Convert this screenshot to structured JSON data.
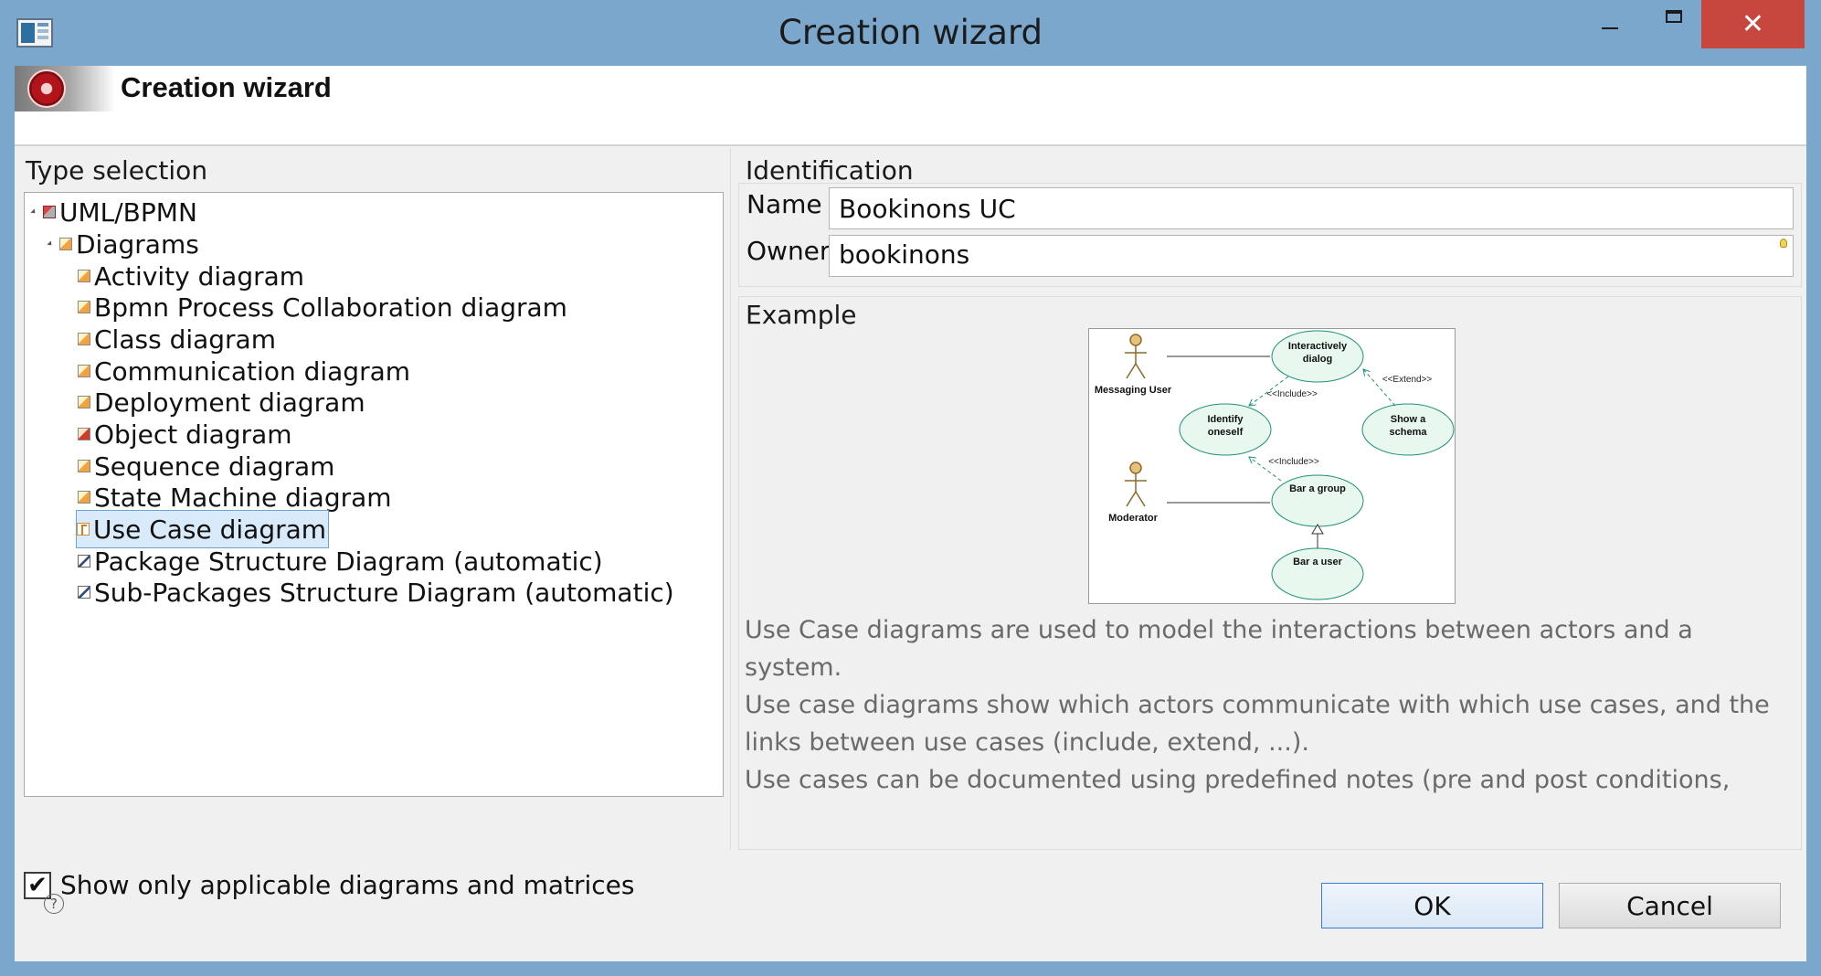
{
  "window": {
    "title": "Creation wizard",
    "close_glyph": "✕"
  },
  "banner": {
    "title": "Creation wizard"
  },
  "type_selection": {
    "label": "Type selection",
    "tree": {
      "root": "UML/BPMN",
      "group": "Diagrams",
      "items": [
        "Activity diagram",
        "Bpmn Process Collaboration diagram",
        "Class diagram",
        "Communication diagram",
        "Deployment diagram",
        "Object diagram",
        "Sequence diagram",
        "State Machine diagram",
        "Use Case diagram",
        "Package Structure Diagram (automatic)",
        "Sub-Packages Structure Diagram (automatic)"
      ],
      "selected": "Use Case diagram"
    },
    "show_only_applicable": {
      "label": "Show only applicable diagrams and matrices",
      "checked": true,
      "check_glyph": "✔"
    }
  },
  "identification": {
    "label": "Identification",
    "name_label": "Name",
    "name_value": "Bookinons UC",
    "owner_label": "Owner",
    "owner_value": "bookinons"
  },
  "example": {
    "label": "Example",
    "diagram": {
      "actors": [
        "Messaging User",
        "Moderator"
      ],
      "use_cases": [
        "Interactively",
        "dialog",
        "Identify",
        "oneself",
        "Show a",
        "schema",
        "Bar a group",
        "Bar a user"
      ],
      "relations": [
        "<<Include>>",
        "<<Extend>>",
        "<<Include>>"
      ]
    },
    "description": [
      "Use Case diagrams are used to model the interactions between actors and a system.",
      "Use case diagrams show which actors communicate with which use cases, and the links between use cases (include, extend, ...).",
      "Use cases can be documented using predefined notes (pre and post conditions, description, exception)."
    ]
  },
  "footer": {
    "help_glyph": "?",
    "ok_label": "OK",
    "cancel_label": "Cancel"
  },
  "colors": {
    "titlebar": "#7ba7cc",
    "close_button": "#c7463d",
    "selection": "#d9ebfb",
    "usecase_fill": "#e8f8ee",
    "usecase_stroke": "#1d8f7a",
    "actor": "#d4a85a"
  }
}
